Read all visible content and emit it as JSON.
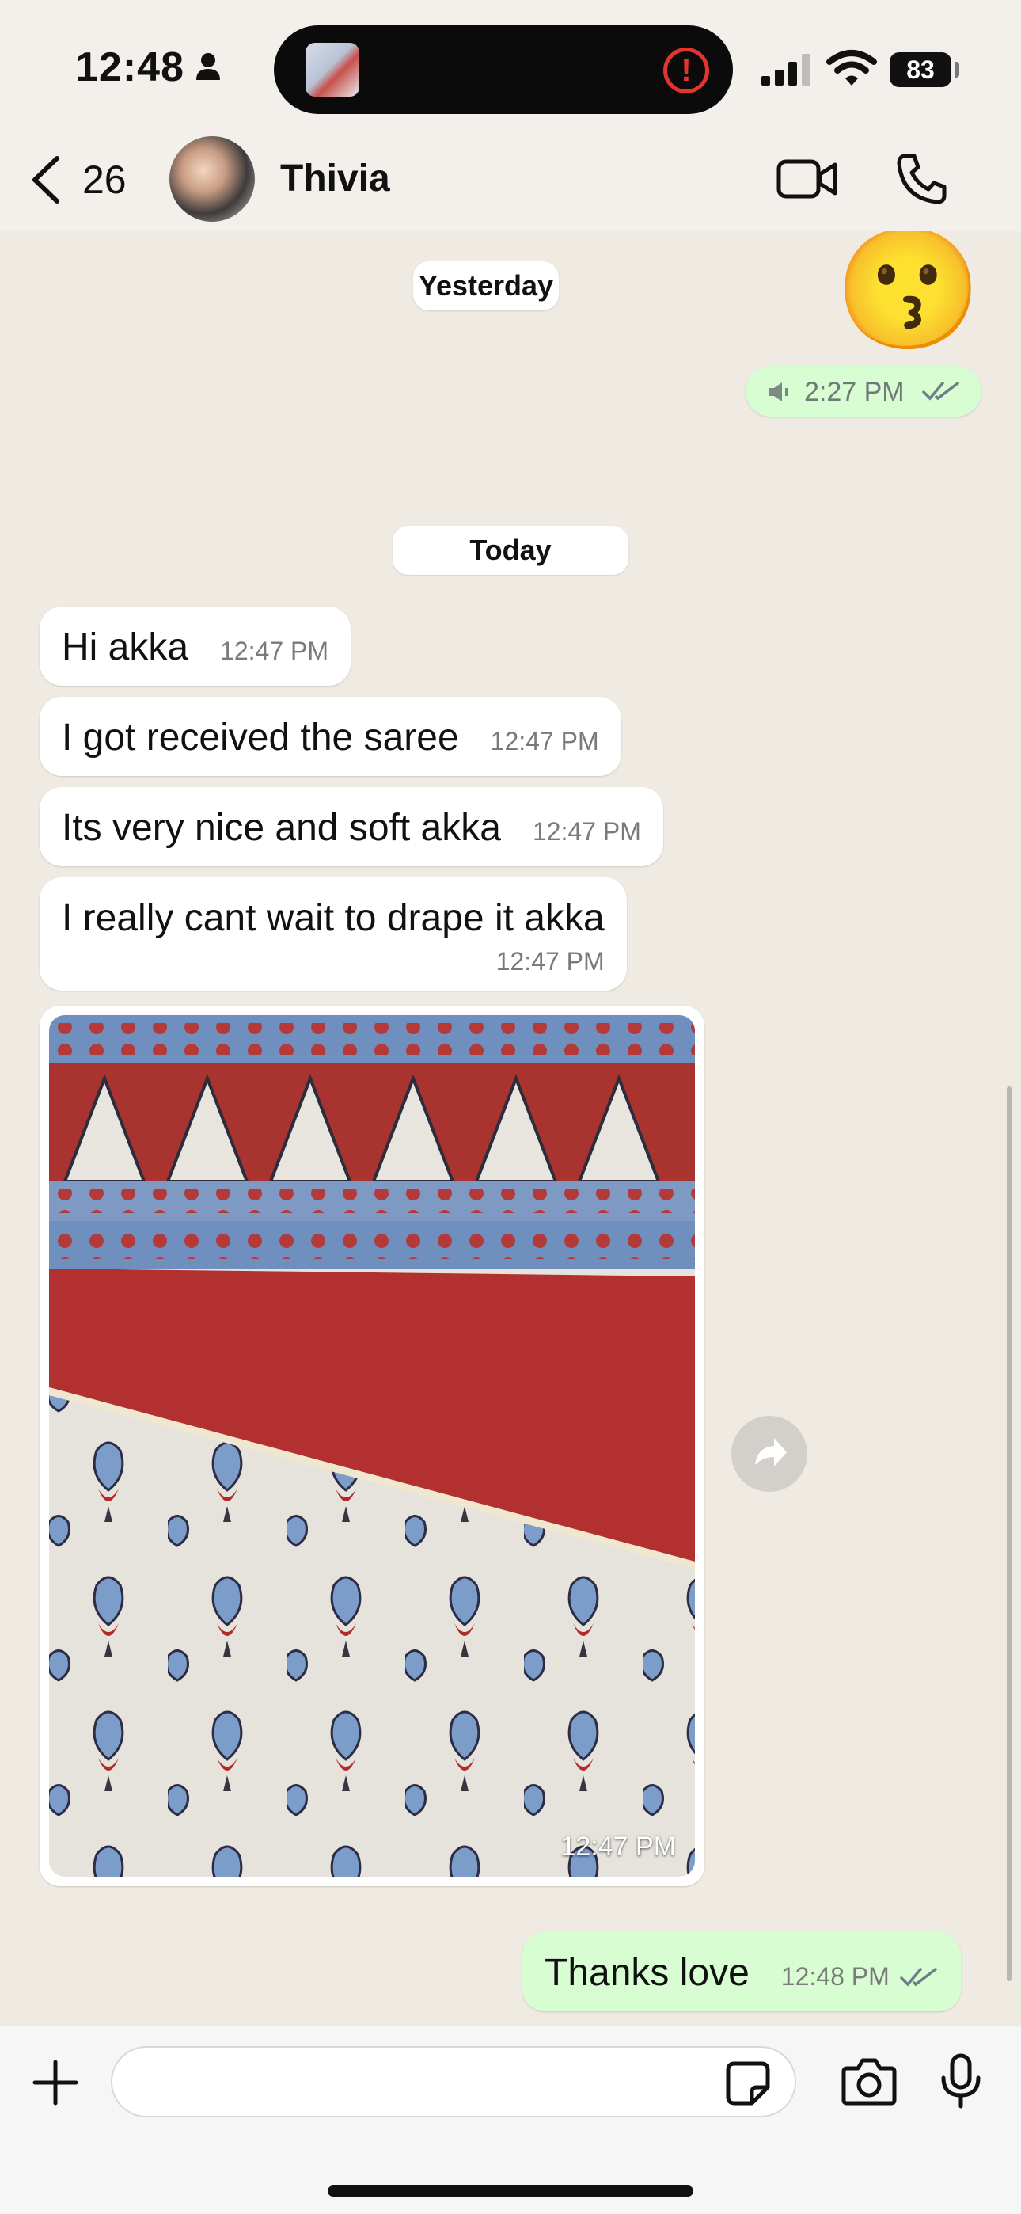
{
  "status_bar": {
    "time": "12:48",
    "battery": "83"
  },
  "header": {
    "back_count": "26",
    "contact_name": "Thivia"
  },
  "chat": {
    "yesterday_label": "Yesterday",
    "yesterday_message": {
      "emoji": "😗",
      "time": "2:27 PM"
    },
    "today_label": "Today",
    "incoming": [
      {
        "text": "Hi akka",
        "time": "12:47 PM"
      },
      {
        "text": "I got received the saree",
        "time": "12:47 PM"
      },
      {
        "text": "Its very nice and soft akka",
        "time": "12:47 PM"
      },
      {
        "text": "I really cant wait to drape it akka",
        "time": "12:47 PM"
      }
    ],
    "image_message": {
      "time": "12:47 PM"
    },
    "outgoing": {
      "text": "Thanks love",
      "time": "12:48 PM"
    }
  },
  "input": {
    "placeholder": ""
  },
  "colors": {
    "outgoing_bubble": "#d9fdd3",
    "incoming_bubble": "#ffffff",
    "chat_background": "#efeae2",
    "read_ticks": "#6f7f8a"
  }
}
